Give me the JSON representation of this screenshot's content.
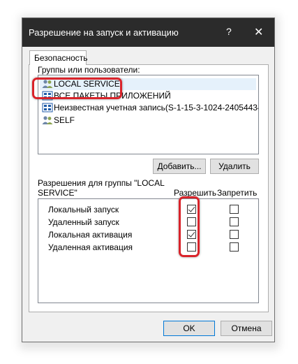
{
  "window": {
    "title": "Разрешение на запуск и активацию",
    "help_glyph": "?",
    "close_glyph": "✕"
  },
  "tab": {
    "label": "Безопасность"
  },
  "groups": {
    "label": "Группы или пользователи:",
    "items": [
      {
        "label": "LOCAL SERVICE",
        "icon": "users-icon"
      },
      {
        "label": "ВСЕ ПАКЕТЫ ПРИЛОЖЕНИЙ",
        "icon": "app-packages-icon"
      },
      {
        "label": "Неизвестная учетная запись(S-1-15-3-1024-2405443489...",
        "icon": "unknown-account-icon"
      },
      {
        "label": "SELF",
        "icon": "users-icon"
      }
    ],
    "selected": "LOCAL SERVICE"
  },
  "buttons": {
    "add": "Добавить...",
    "remove": "Удалить",
    "ok": "OK",
    "cancel": "Отмена"
  },
  "permissions": {
    "label_line1": "Разрешения для группы \"LOCAL",
    "label_line2": "SERVICE\"",
    "allow_header": "Разрешить",
    "deny_header": "Запретить",
    "rows": [
      {
        "name": "Локальный запуск",
        "allow": true,
        "deny": false
      },
      {
        "name": "Удаленный запуск",
        "allow": false,
        "deny": false
      },
      {
        "name": "Локальная активация",
        "allow": true,
        "deny": false
      },
      {
        "name": "Удаленная активация",
        "allow": false,
        "deny": false
      }
    ]
  },
  "colors": {
    "titlebar": "#2b2b2b",
    "highlight": "#d9232a",
    "default_button_border": "#0078d7"
  }
}
